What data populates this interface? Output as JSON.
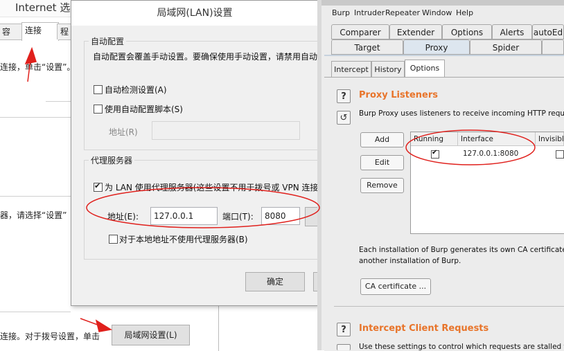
{
  "internet_options": {
    "title": "Internet 选",
    "tabs": [
      "容",
      "连接",
      "程"
    ],
    "text_line1": "连接，单击“设置”。",
    "text_line2": "器，请选择“设置”",
    "text_line3": "连接。对于拨号设置，单击",
    "lan_button": "局域网设置(L)"
  },
  "lan_dialog": {
    "title": "局域网(LAN)设置",
    "auto_config_group": "自动配置",
    "auto_config_desc": "自动配置会覆盖手动设置。要确保使用手动设置，请禁用自动",
    "auto_detect_label": "自动检测设置(A)",
    "auto_script_label": "使用自动配置脚本(S)",
    "address_label_dim": "地址(R)",
    "proxy_group": "代理服务器",
    "use_proxy_label": "为 LAN 使用代理服务器(这些设置不用于拨号或 VPN 连接",
    "address_label": "地址(E):",
    "address_value": "127.0.0.1",
    "port_label": "端口(T):",
    "port_value": "8080",
    "bypass_label": "对于本地地址不使用代理服务器(B)",
    "ok_button": "确定"
  },
  "burp": {
    "menu": [
      "Burp",
      "Intruder",
      "Repeater",
      "Window",
      "Help"
    ],
    "tabs_row1": [
      "Comparer",
      "Extender",
      "Options",
      "Alerts",
      "autoEd"
    ],
    "tabs_row2": [
      "Target",
      "Proxy",
      "Spider"
    ],
    "subtabs": [
      "Intercept",
      "History",
      "Options"
    ],
    "help_icon": "?",
    "refresh_icon": "↺",
    "listeners_title": "Proxy Listeners",
    "listeners_desc": "Burp Proxy uses listeners to receive incoming HTTP requests f",
    "buttons": {
      "add": "Add",
      "edit": "Edit",
      "remove": "Remove"
    },
    "table": {
      "headers": [
        "Running",
        "Interface",
        "Invisible"
      ],
      "row": {
        "running": true,
        "interface": "127.0.0.1:8080",
        "invisible": false
      }
    },
    "ca_line1": "Each installation of Burp generates its own CA certificate that I",
    "ca_line2": "another installation of Burp.",
    "ca_button": "CA certificate ...",
    "intercept_title": "Intercept Client Requests",
    "intercept_desc": "Use these settings to control which requests are stalled for vie"
  },
  "annotations": {
    "color": "#e0201c"
  }
}
